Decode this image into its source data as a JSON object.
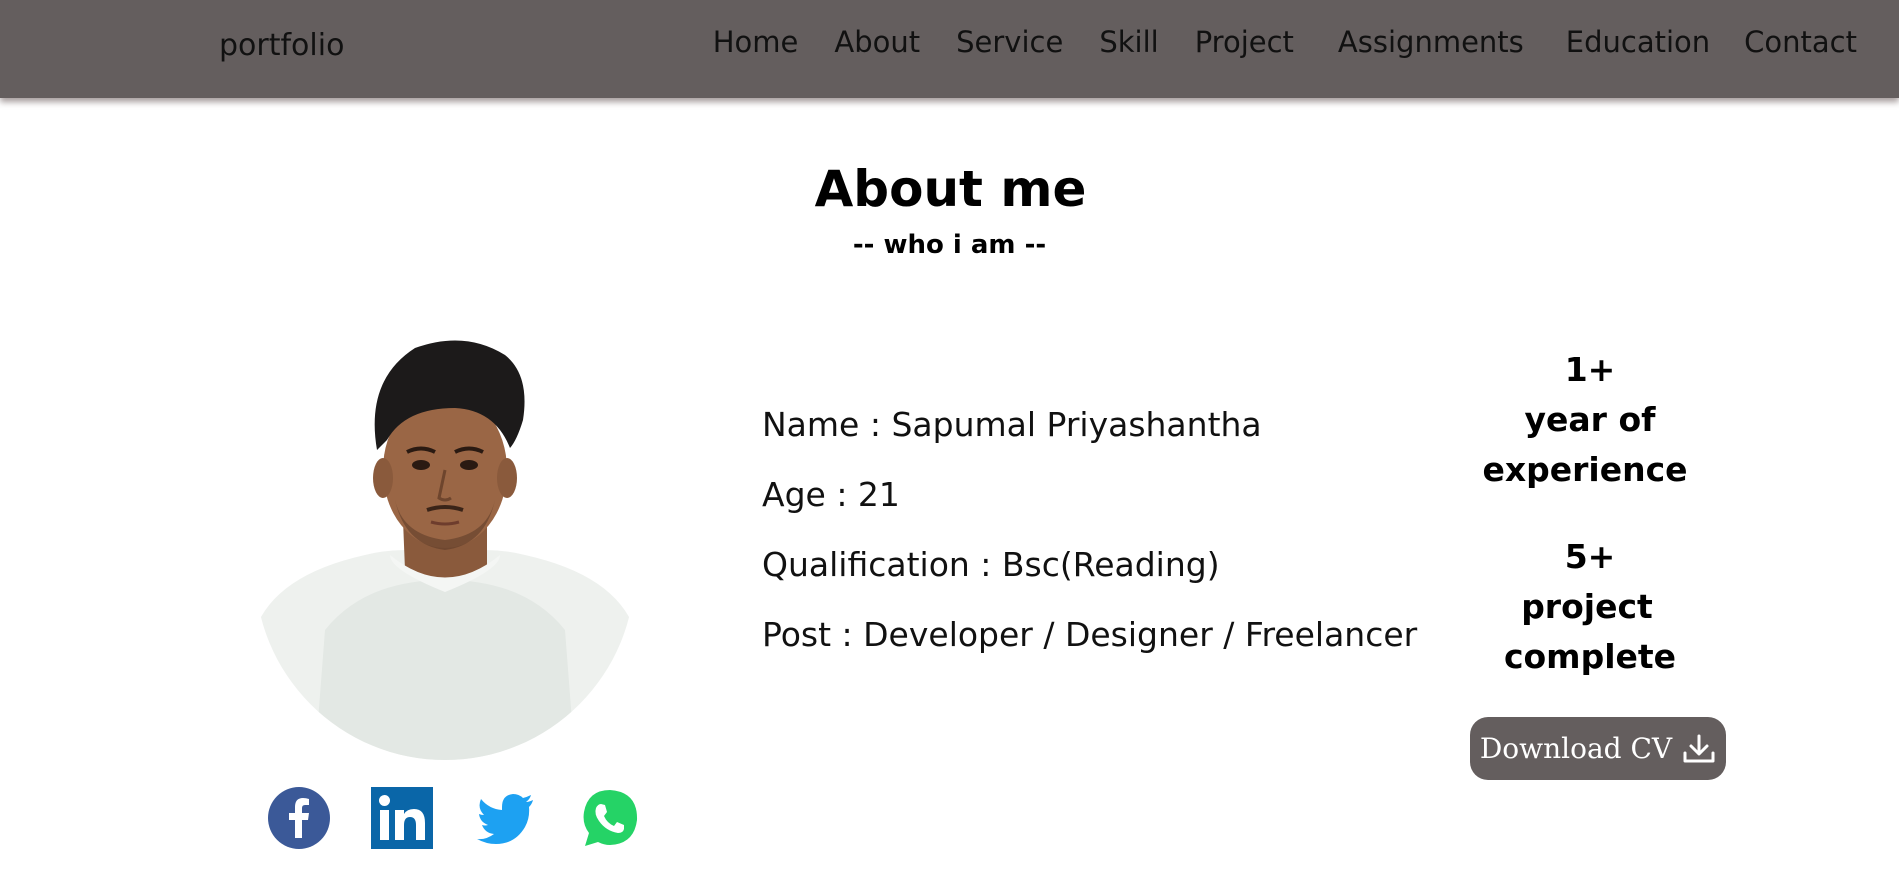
{
  "header": {
    "brand": "portfolio",
    "nav": [
      "Home",
      "About",
      "Service",
      "Skill",
      "Project",
      "Assignments",
      "Education",
      "Contact"
    ]
  },
  "about": {
    "title": "About me",
    "subtitle": "-- who i am --",
    "info": {
      "name": "Name : Sapumal Priyashantha",
      "age": "Age : 21",
      "qualification": "Qualification : Bsc(Reading)",
      "post": "Post : Developer / Designer / Freelancer"
    },
    "stats": {
      "experience_value": "1+",
      "experience_line1": "year of",
      "experience_line2": "experience",
      "projects_value": "5+",
      "projects_line1": "project",
      "projects_line2": "complete"
    },
    "download_label": "Download CV"
  },
  "social": [
    "facebook-icon",
    "linkedin-icon",
    "twitter-icon",
    "whatsapp-icon"
  ],
  "colors": {
    "navbar": "#645e5e",
    "button": "#645e5e",
    "facebook": "#3b5998",
    "linkedin": "#0a66a8",
    "twitter": "#1da1f2",
    "whatsapp": "#25d366"
  }
}
